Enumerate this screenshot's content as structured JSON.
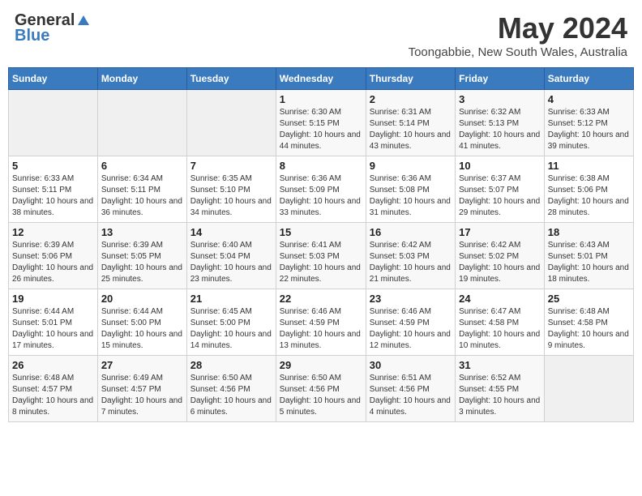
{
  "header": {
    "logo_general": "General",
    "logo_blue": "Blue",
    "month_title": "May 2024",
    "location": "Toongabbie, New South Wales, Australia"
  },
  "weekdays": [
    "Sunday",
    "Monday",
    "Tuesday",
    "Wednesday",
    "Thursday",
    "Friday",
    "Saturday"
  ],
  "weeks": [
    [
      {
        "day": "",
        "info": ""
      },
      {
        "day": "",
        "info": ""
      },
      {
        "day": "",
        "info": ""
      },
      {
        "day": "1",
        "info": "Sunrise: 6:30 AM\nSunset: 5:15 PM\nDaylight: 10 hours\nand 44 minutes."
      },
      {
        "day": "2",
        "info": "Sunrise: 6:31 AM\nSunset: 5:14 PM\nDaylight: 10 hours\nand 43 minutes."
      },
      {
        "day": "3",
        "info": "Sunrise: 6:32 AM\nSunset: 5:13 PM\nDaylight: 10 hours\nand 41 minutes."
      },
      {
        "day": "4",
        "info": "Sunrise: 6:33 AM\nSunset: 5:12 PM\nDaylight: 10 hours\nand 39 minutes."
      }
    ],
    [
      {
        "day": "5",
        "info": "Sunrise: 6:33 AM\nSunset: 5:11 PM\nDaylight: 10 hours\nand 38 minutes."
      },
      {
        "day": "6",
        "info": "Sunrise: 6:34 AM\nSunset: 5:11 PM\nDaylight: 10 hours\nand 36 minutes."
      },
      {
        "day": "7",
        "info": "Sunrise: 6:35 AM\nSunset: 5:10 PM\nDaylight: 10 hours\nand 34 minutes."
      },
      {
        "day": "8",
        "info": "Sunrise: 6:36 AM\nSunset: 5:09 PM\nDaylight: 10 hours\nand 33 minutes."
      },
      {
        "day": "9",
        "info": "Sunrise: 6:36 AM\nSunset: 5:08 PM\nDaylight: 10 hours\nand 31 minutes."
      },
      {
        "day": "10",
        "info": "Sunrise: 6:37 AM\nSunset: 5:07 PM\nDaylight: 10 hours\nand 29 minutes."
      },
      {
        "day": "11",
        "info": "Sunrise: 6:38 AM\nSunset: 5:06 PM\nDaylight: 10 hours\nand 28 minutes."
      }
    ],
    [
      {
        "day": "12",
        "info": "Sunrise: 6:39 AM\nSunset: 5:06 PM\nDaylight: 10 hours\nand 26 minutes."
      },
      {
        "day": "13",
        "info": "Sunrise: 6:39 AM\nSunset: 5:05 PM\nDaylight: 10 hours\nand 25 minutes."
      },
      {
        "day": "14",
        "info": "Sunrise: 6:40 AM\nSunset: 5:04 PM\nDaylight: 10 hours\nand 23 minutes."
      },
      {
        "day": "15",
        "info": "Sunrise: 6:41 AM\nSunset: 5:03 PM\nDaylight: 10 hours\nand 22 minutes."
      },
      {
        "day": "16",
        "info": "Sunrise: 6:42 AM\nSunset: 5:03 PM\nDaylight: 10 hours\nand 21 minutes."
      },
      {
        "day": "17",
        "info": "Sunrise: 6:42 AM\nSunset: 5:02 PM\nDaylight: 10 hours\nand 19 minutes."
      },
      {
        "day": "18",
        "info": "Sunrise: 6:43 AM\nSunset: 5:01 PM\nDaylight: 10 hours\nand 18 minutes."
      }
    ],
    [
      {
        "day": "19",
        "info": "Sunrise: 6:44 AM\nSunset: 5:01 PM\nDaylight: 10 hours\nand 17 minutes."
      },
      {
        "day": "20",
        "info": "Sunrise: 6:44 AM\nSunset: 5:00 PM\nDaylight: 10 hours\nand 15 minutes."
      },
      {
        "day": "21",
        "info": "Sunrise: 6:45 AM\nSunset: 5:00 PM\nDaylight: 10 hours\nand 14 minutes."
      },
      {
        "day": "22",
        "info": "Sunrise: 6:46 AM\nSunset: 4:59 PM\nDaylight: 10 hours\nand 13 minutes."
      },
      {
        "day": "23",
        "info": "Sunrise: 6:46 AM\nSunset: 4:59 PM\nDaylight: 10 hours\nand 12 minutes."
      },
      {
        "day": "24",
        "info": "Sunrise: 6:47 AM\nSunset: 4:58 PM\nDaylight: 10 hours\nand 10 minutes."
      },
      {
        "day": "25",
        "info": "Sunrise: 6:48 AM\nSunset: 4:58 PM\nDaylight: 10 hours\nand 9 minutes."
      }
    ],
    [
      {
        "day": "26",
        "info": "Sunrise: 6:48 AM\nSunset: 4:57 PM\nDaylight: 10 hours\nand 8 minutes."
      },
      {
        "day": "27",
        "info": "Sunrise: 6:49 AM\nSunset: 4:57 PM\nDaylight: 10 hours\nand 7 minutes."
      },
      {
        "day": "28",
        "info": "Sunrise: 6:50 AM\nSunset: 4:56 PM\nDaylight: 10 hours\nand 6 minutes."
      },
      {
        "day": "29",
        "info": "Sunrise: 6:50 AM\nSunset: 4:56 PM\nDaylight: 10 hours\nand 5 minutes."
      },
      {
        "day": "30",
        "info": "Sunrise: 6:51 AM\nSunset: 4:56 PM\nDaylight: 10 hours\nand 4 minutes."
      },
      {
        "day": "31",
        "info": "Sunrise: 6:52 AM\nSunset: 4:55 PM\nDaylight: 10 hours\nand 3 minutes."
      },
      {
        "day": "",
        "info": ""
      }
    ]
  ]
}
